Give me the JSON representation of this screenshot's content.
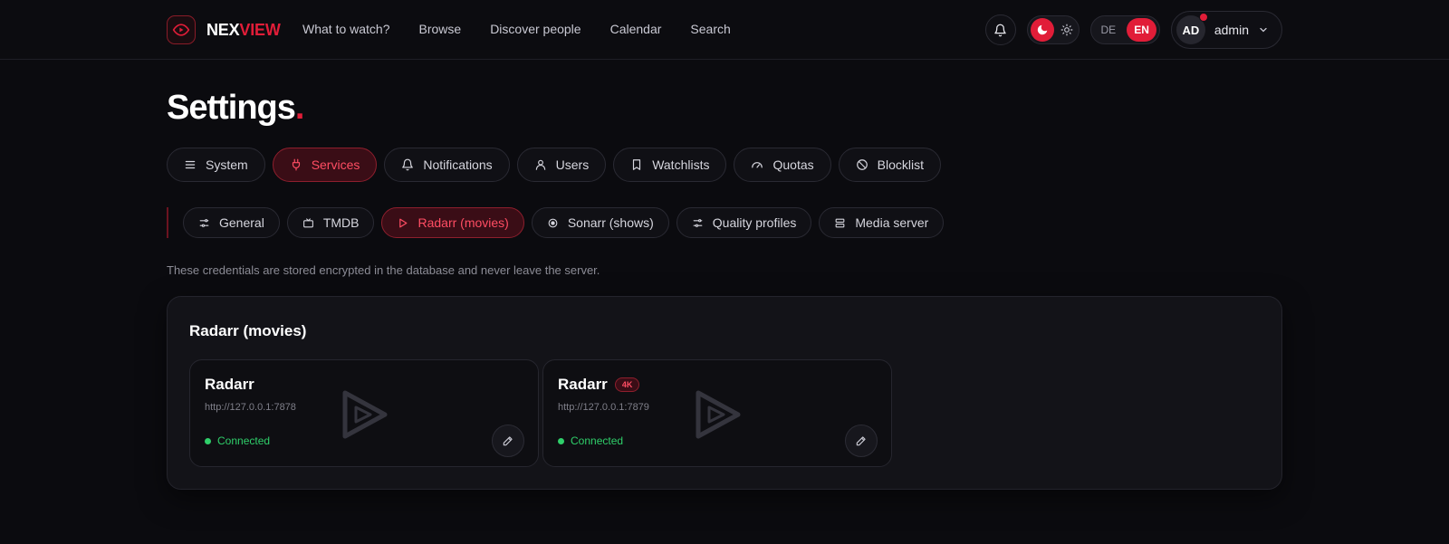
{
  "brand": {
    "part1": "NEX",
    "part2": "VIEW"
  },
  "nav": [
    "What to watch?",
    "Browse",
    "Discover people",
    "Calendar",
    "Search"
  ],
  "lang": {
    "de": "DE",
    "en": "EN",
    "active": "EN"
  },
  "user": {
    "initials": "AD",
    "name": "admin"
  },
  "page": {
    "title": "Settings",
    "title_dot": "."
  },
  "tabs": [
    {
      "label": "System",
      "icon": "menu-icon"
    },
    {
      "label": "Services",
      "icon": "plug-icon",
      "active": true
    },
    {
      "label": "Notifications",
      "icon": "bell-icon"
    },
    {
      "label": "Users",
      "icon": "user-icon"
    },
    {
      "label": "Watchlists",
      "icon": "bookmark-icon"
    },
    {
      "label": "Quotas",
      "icon": "gauge-icon"
    },
    {
      "label": "Blocklist",
      "icon": "ban-icon"
    }
  ],
  "subtabs": [
    {
      "label": "General",
      "icon": "sliders-icon"
    },
    {
      "label": "TMDB",
      "icon": "tv-icon"
    },
    {
      "label": "Radarr (movies)",
      "icon": "play-icon",
      "active": true
    },
    {
      "label": "Sonarr (shows)",
      "icon": "record-icon"
    },
    {
      "label": "Quality profiles",
      "icon": "sliders-icon"
    },
    {
      "label": "Media server",
      "icon": "server-icon"
    }
  ],
  "hint": "These credentials are stored encrypted in the database and never leave the server.",
  "section": {
    "title": "Radarr (movies)"
  },
  "services": [
    {
      "name": "Radarr",
      "badge": "",
      "url": "http://127.0.0.1:7878",
      "status": "Connected"
    },
    {
      "name": "Radarr",
      "badge": "4K",
      "url": "http://127.0.0.1:7879",
      "status": "Connected"
    }
  ],
  "colors": {
    "accent": "#e11d38",
    "connected": "#2fcf6a",
    "background": "#0b0b0f"
  }
}
